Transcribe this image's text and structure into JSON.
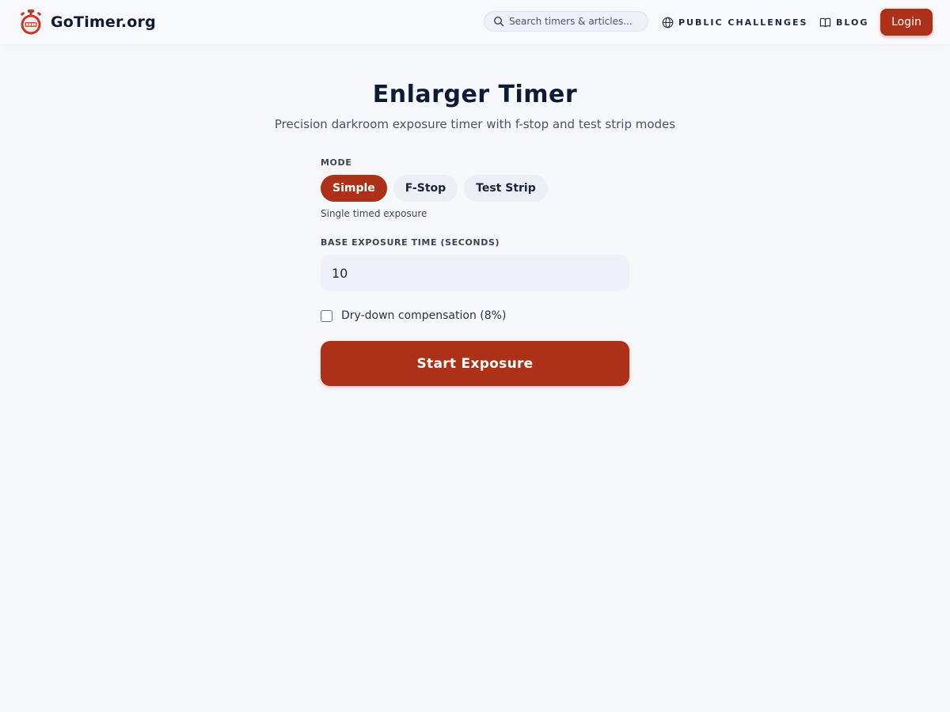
{
  "header": {
    "brand_name": "GoTimer.org",
    "logo_icon": "stopwatch-logo-icon",
    "search": {
      "placeholder": "Search timers & articles...",
      "icon": "search-icon"
    },
    "nav": [
      {
        "label": "PUBLIC CHALLENGES",
        "icon": "globe-icon"
      },
      {
        "label": "BLOG",
        "icon": "book-icon"
      }
    ],
    "login_label": "Login"
  },
  "main": {
    "title": "Enlarger Timer",
    "subtitle": "Precision darkroom exposure timer with f-stop and test strip modes",
    "mode": {
      "label": "MODE",
      "options": [
        "Simple",
        "F-Stop",
        "Test Strip"
      ],
      "selected": "Simple",
      "description": "Single timed exposure"
    },
    "base_time": {
      "label": "BASE EXPOSURE TIME (SECONDS)",
      "value": "10"
    },
    "dry_down": {
      "label": "Dry-down compensation (8%)",
      "checked": false
    },
    "start_label": "Start Exposure"
  },
  "colors": {
    "accent": "#ad3119",
    "background": "#f7f8fc",
    "text": "#0f1b33",
    "input_bg": "#eef1f7"
  }
}
